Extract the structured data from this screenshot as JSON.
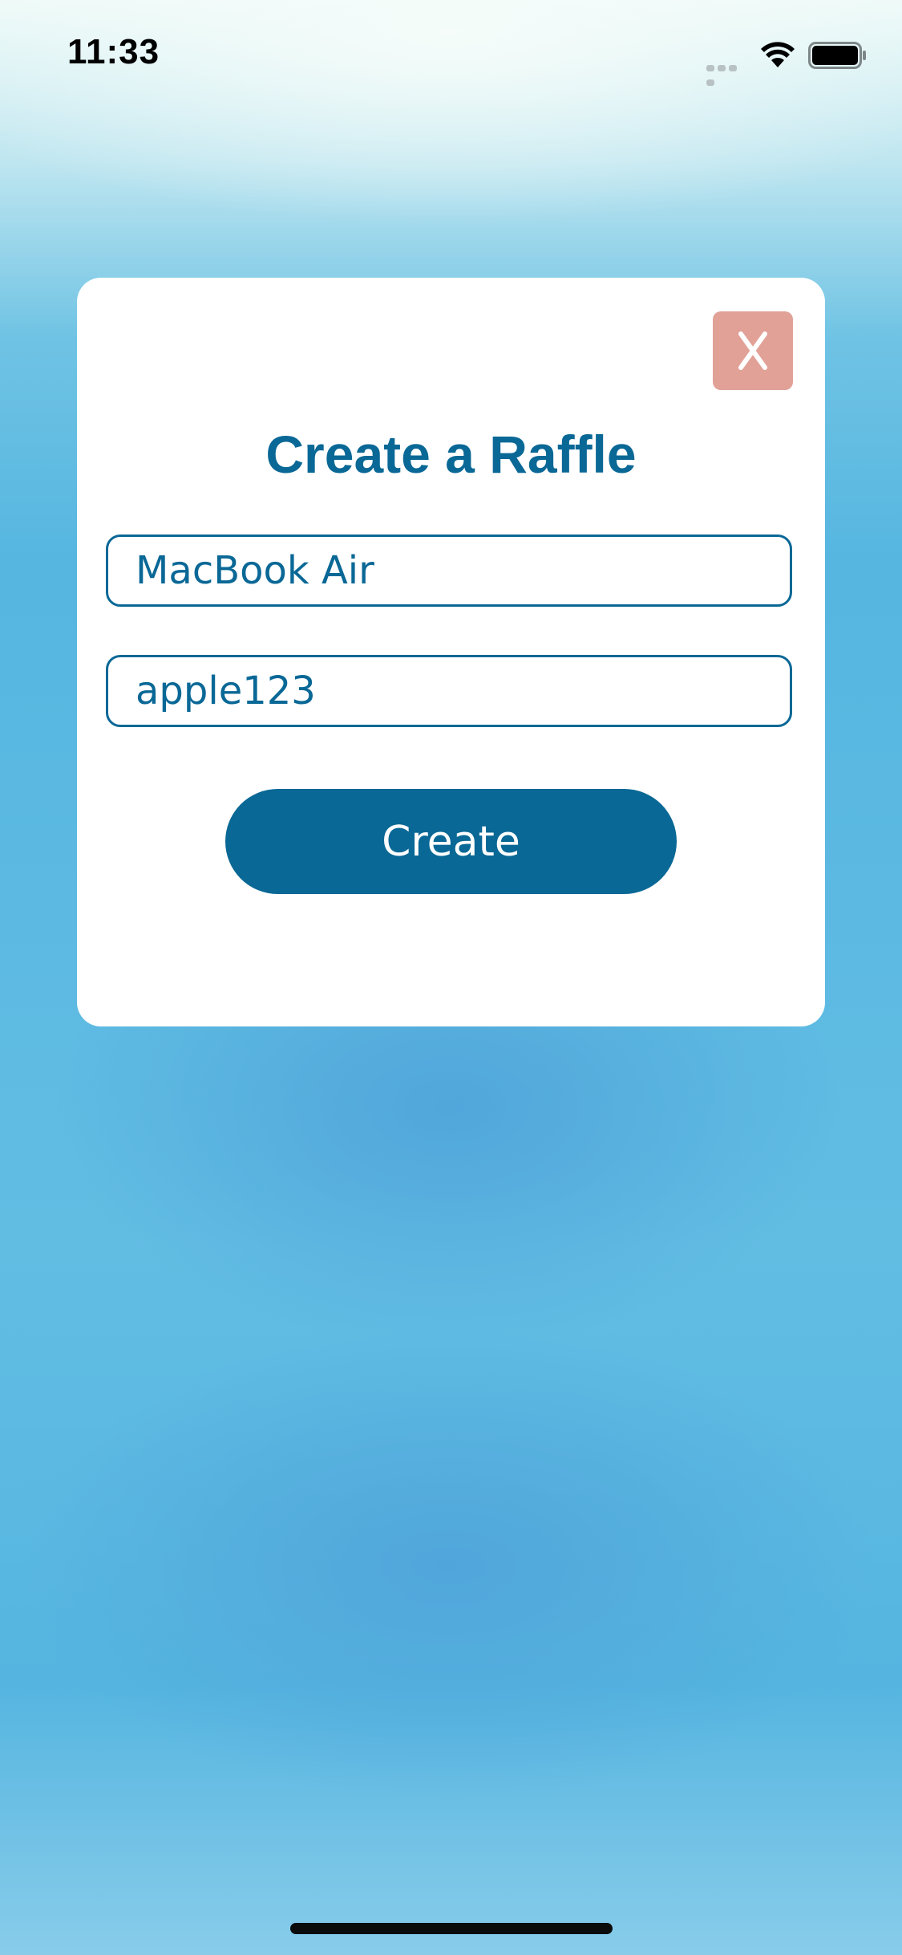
{
  "status_bar": {
    "time": "11:33",
    "icons": [
      "signal-dots-icon",
      "wifi-icon",
      "battery-icon"
    ]
  },
  "modal": {
    "close_label": "X",
    "title": "Create a Raffle",
    "fields": [
      {
        "value": "MacBook Air"
      },
      {
        "value": "apple123"
      }
    ],
    "create_label": "Create"
  },
  "colors": {
    "accent": "#0a6896",
    "close_button": "#e1a197",
    "card": "#ffffff",
    "background": "#56b6e0"
  }
}
